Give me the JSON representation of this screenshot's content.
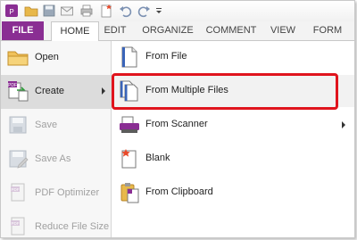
{
  "tabs": {
    "file": "FILE",
    "home": "HOME",
    "edit": "EDIT",
    "organize": "ORGANIZE",
    "comment": "COMMENT",
    "view": "VIEW",
    "form": "FORM"
  },
  "left_menu": [
    {
      "label": "Open",
      "icon": "folder-icon",
      "state": "enabled"
    },
    {
      "label": "Create",
      "icon": "create-pdf-icon",
      "state": "selected"
    },
    {
      "label": "Save",
      "icon": "save-icon",
      "state": "disabled"
    },
    {
      "label": "Save As",
      "icon": "save-as-icon",
      "state": "disabled"
    },
    {
      "label": "PDF Optimizer",
      "icon": "pdf-optimizer-icon",
      "state": "disabled"
    },
    {
      "label": "Reduce File Size",
      "icon": "reduce-file-size-icon",
      "state": "disabled"
    }
  ],
  "create_submenu": [
    {
      "label": "From File",
      "icon": "document-icon"
    },
    {
      "label": "From Multiple Files",
      "icon": "multiple-documents-icon",
      "highlighted": true
    },
    {
      "label": "From Scanner",
      "icon": "scanner-icon",
      "has_submenu": true
    },
    {
      "label": "Blank",
      "icon": "blank-page-icon"
    },
    {
      "label": "From Clipboard",
      "icon": "clipboard-icon"
    }
  ],
  "colors": {
    "file_tab": "#8a2e93",
    "highlight_box": "#e0141d"
  }
}
